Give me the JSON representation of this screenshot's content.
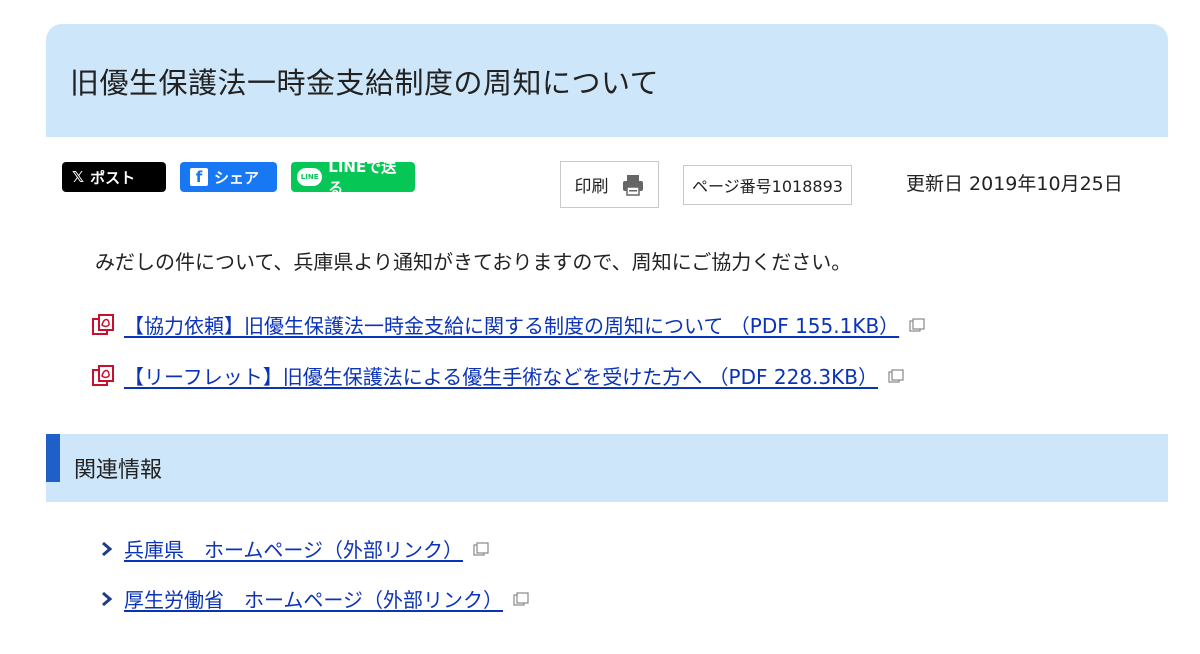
{
  "page": {
    "title": "旧優生保護法一時金支給制度の周知について"
  },
  "social": {
    "x_label": "ポスト",
    "x_glyph": "𝕏",
    "fb_label": "シェア",
    "fb_glyph": "f",
    "line_label": "LINEで送る",
    "line_glyph": "LINE"
  },
  "meta": {
    "print_label": "印刷",
    "page_number": "ページ番号1018893",
    "updated": "更新日 2019年10月25日"
  },
  "content": {
    "intro": "みだしの件について、兵庫県より通知がきておりますので、周知にご協力ください。",
    "files": [
      {
        "label": "【協力依頼】旧優生保護法一時金支給に関する制度の周知について （PDF 155.1KB）"
      },
      {
        "label": "【リーフレット】旧優生保護法による優生手術などを受けた方へ （PDF 228.3KB）"
      }
    ]
  },
  "related": {
    "heading": "関連情報",
    "links": [
      {
        "label": "兵庫県　ホームページ（外部リンク）"
      },
      {
        "label": "厚生労働省　ホームページ（外部リンク）"
      }
    ]
  },
  "colors": {
    "banner_bg": "#cde6f9",
    "link": "#0b33b7",
    "accent_bar": "#1f5fc8",
    "pdf_red": "#c8102e",
    "x_black": "#000000",
    "fb_blue": "#1877f2",
    "line_green": "#06c755"
  }
}
